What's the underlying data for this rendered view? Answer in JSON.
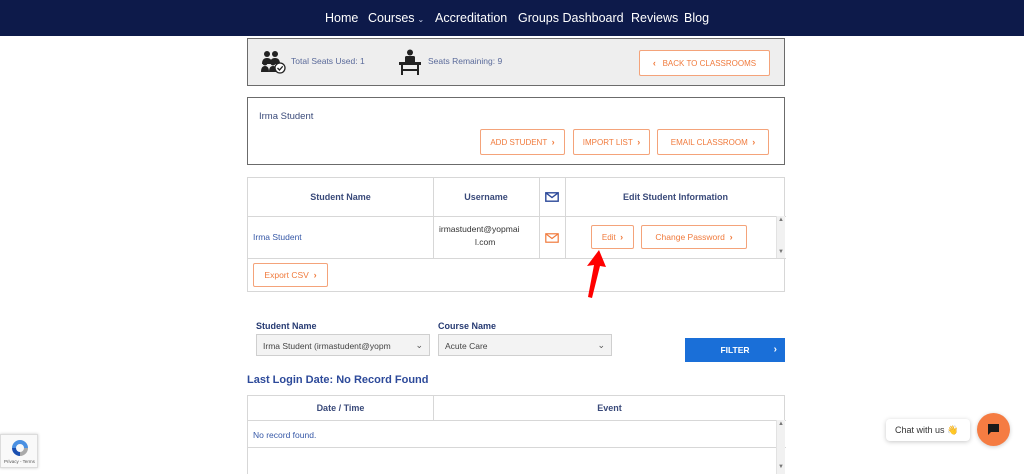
{
  "nav": {
    "items": [
      "Home",
      "Courses",
      "Accreditation",
      "Groups Dashboard",
      "Reviews",
      "Blog"
    ]
  },
  "seats": {
    "total_used_label": "Total Seats Used: 1",
    "remaining_label": "Seats Remaining: 9",
    "back_button": "BACK TO CLASSROOMS"
  },
  "student_panel": {
    "name": "Irma Student",
    "add_student": "ADD STUDENT",
    "import_list": "IMPORT LIST",
    "email_classroom": "EMAIL CLASSROOM"
  },
  "students_table": {
    "headers": [
      "Student Name",
      "Username",
      "Edit Student Information"
    ],
    "rows": [
      {
        "name": "Irma Student",
        "username_line1": "irmastudent@yopmai",
        "username_line2": "l.com",
        "edit": "Edit",
        "change_password": "Change Password"
      }
    ],
    "export_csv": "Export CSV"
  },
  "filters": {
    "student_label": "Student Name",
    "student_value": "Irma Student (irmastudent@yopm",
    "course_label": "Course Name",
    "course_value": "Acute Care",
    "filter_button": "FILTER"
  },
  "login_section": {
    "title": "Last Login Date: No Record Found",
    "headers": [
      "Date / Time",
      "Event"
    ],
    "empty_text": "No record found."
  },
  "recaptcha": {
    "text": "Privacy - Terms"
  },
  "chat": {
    "label": "Chat with us",
    "emoji": "👋"
  },
  "colors": {
    "nav_bg": "#0d1a4a",
    "accent_orange": "#f07a3c",
    "filter_blue": "#1a6fd8",
    "annotation_red": "#ff0000"
  }
}
